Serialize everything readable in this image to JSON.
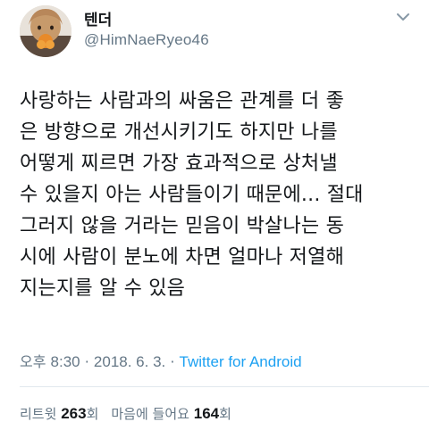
{
  "tweet": {
    "display_name": "텐더",
    "handle": "@HimNaeRyeo46",
    "body_lines": [
      "사랑하는 사람과의 싸움은 관계를 더 좋",
      "은 방향으로 개선시키기도 하지만 나를",
      "어떻게 찌르면 가장 효과적으로 상처낼",
      "수 있을지 아는 사람들이기 때문에... 절대",
      "그러지 않을 거라는 믿음이 박살나는 동",
      "시에 사람이 분노에 차면 얼마나 저열해",
      "지는지를 알 수 있음"
    ],
    "time_prefix": "오후",
    "time": "8:30",
    "separator": "·",
    "date": "2018. 6. 3.",
    "source": "Twitter for Android",
    "retweets_label": "리트윗",
    "retweets_count": "263",
    "retweets_unit": "회",
    "likes_label": "마음에 들어요",
    "likes_count": "164",
    "likes_unit": "회"
  },
  "colors": {
    "text": "#14171a",
    "secondary": "#657786",
    "link": "#1da1f2",
    "divider": "#e1e8ed"
  },
  "icons": {
    "caret": "chevron-down-icon"
  }
}
